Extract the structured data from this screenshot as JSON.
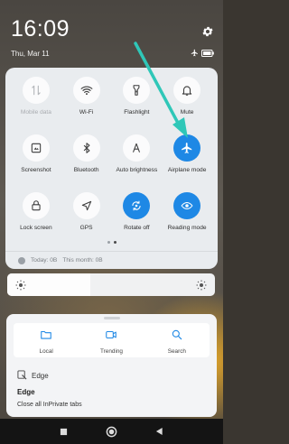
{
  "status_bar": {
    "time": "16:09",
    "date": "Thu, Mar 11"
  },
  "quick_settings": {
    "tiles": [
      {
        "label": "Mobile data",
        "icon": "mobile-data-icon",
        "state": "disabled"
      },
      {
        "label": "Wi-Fi",
        "icon": "wifi-icon",
        "state": "off"
      },
      {
        "label": "Flashlight",
        "icon": "flashlight-icon",
        "state": "off"
      },
      {
        "label": "Mute",
        "icon": "bell-icon",
        "state": "off"
      },
      {
        "label": "Screenshot",
        "icon": "screenshot-icon",
        "state": "off"
      },
      {
        "label": "Bluetooth",
        "icon": "bluetooth-icon",
        "state": "off"
      },
      {
        "label": "Auto brightness",
        "icon": "auto-brightness-icon",
        "state": "off"
      },
      {
        "label": "Airplane mode",
        "icon": "airplane-icon",
        "state": "on"
      },
      {
        "label": "Lock screen",
        "icon": "lock-icon",
        "state": "off"
      },
      {
        "label": "GPS",
        "icon": "gps-icon",
        "state": "off"
      },
      {
        "label": "Rotate off",
        "icon": "rotate-icon",
        "state": "on"
      },
      {
        "label": "Reading mode",
        "icon": "eye-icon",
        "state": "on"
      }
    ],
    "page_count": 2,
    "active_page": 2,
    "data_usage": {
      "today": "Today: 0B",
      "month": "This month: 0B"
    }
  },
  "brightness": {
    "level": 0.4
  },
  "notification": {
    "actions": [
      {
        "label": "Local",
        "icon": "folder-icon"
      },
      {
        "label": "Trending",
        "icon": "video-icon"
      },
      {
        "label": "Search",
        "icon": "search-icon"
      }
    ],
    "app_name": "Edge",
    "title": "Edge",
    "text": "Close all InPrivate tabs"
  },
  "colors": {
    "accent": "#1e88e5",
    "annotation_arrow": "#2fc7b8"
  }
}
